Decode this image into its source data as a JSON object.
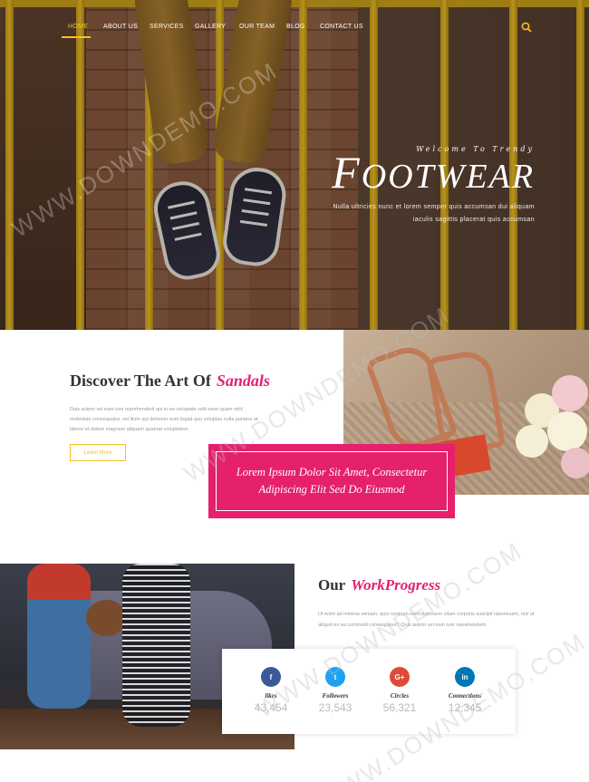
{
  "nav": {
    "items": [
      "HOME",
      "ABOUT US",
      "SERVICES",
      "GALLERY",
      "OUR TEAM",
      "BLOG",
      "CONTACT US"
    ],
    "active_index": 0,
    "accent_color": "#f4c21f",
    "search_icon": "search-icon"
  },
  "hero": {
    "welcome": "Welcome To Trendy",
    "title_first": "F",
    "title_rest": "OOTWEAR",
    "subtitle_line1": "Nulla ultricies nunc et lorem semper quis accumsan dui aliquam",
    "subtitle_line2": "iaculis sagittis placerat quis accumsan"
  },
  "sandals": {
    "title": "Discover The Art Of",
    "title_accent": "Sandals",
    "text": "Duis autem vel eum iure reprehenderit qui in ea voluptate velit esse quam nihil molestiae consequatur, vel illum qui dolorem eum fugiat quo voluptas nulla pariatur at labore et dolore magnam aliquam quaerat voluptatem.",
    "button_label": "Learn More",
    "accent_color": "#e51f71"
  },
  "promo": {
    "line1": "Lorem Ipsum Dolor Sit Amet, Consectetur",
    "line2": "Adipiscing Elit Sed Do Eiusmod",
    "background_color": "#e5206d"
  },
  "work": {
    "title": "Our",
    "title_accent": "WorkProgress",
    "text": "Ut enim ad minima veniam, quis nostrum exercitationem ullam corporis suscipit laboriosam, nisi ut aliquid ex ea commodi consequatur? Quis autem vel eum iure reprehenderit."
  },
  "stats": [
    {
      "icon": "facebook-icon",
      "glyph": "f",
      "label": "likes",
      "value": "43,454",
      "color": "#3b5998"
    },
    {
      "icon": "twitter-icon",
      "glyph": "t",
      "label": "Followers",
      "value": "23,543",
      "color": "#1da1f2"
    },
    {
      "icon": "google-plus-icon",
      "glyph": "G+",
      "label": "Circles",
      "value": "56,321",
      "color": "#dd4b39"
    },
    {
      "icon": "linkedin-icon",
      "glyph": "in",
      "label": "Connections",
      "value": "12,345",
      "color": "#0077b5"
    }
  ],
  "watermark": "WWW.DOWNDEMO.COM"
}
